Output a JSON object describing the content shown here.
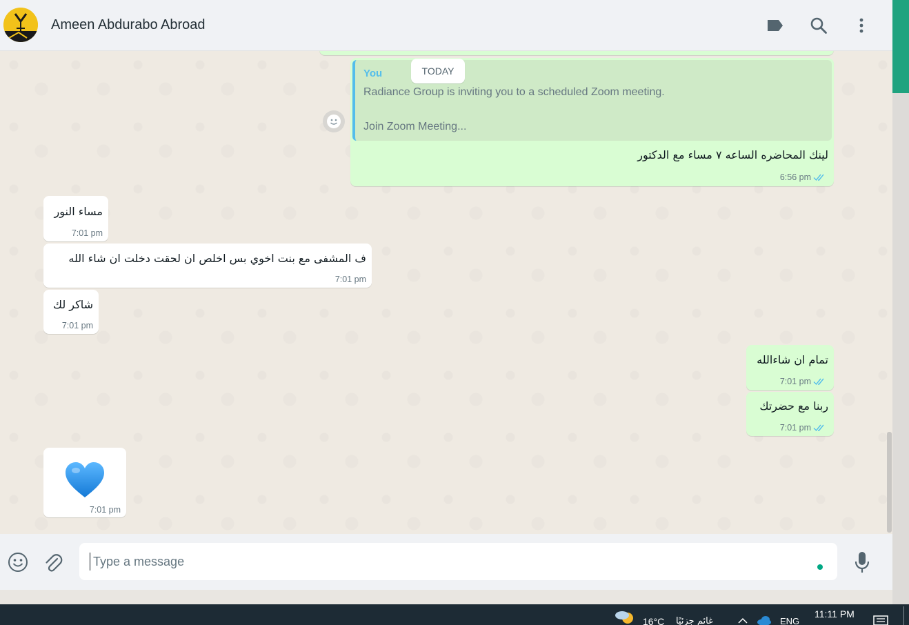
{
  "colors": {
    "accent": "#00a884",
    "outgoing_bubble": "#d9fdd3",
    "incoming_bubble": "#ffffff",
    "tick_read": "#53bdeb",
    "chat_bg": "#efeae2"
  },
  "header": {
    "contact_name": "Ameen Abdurabo Abroad",
    "icons": [
      "label-icon",
      "search-icon",
      "menu-dots-icon"
    ]
  },
  "chat": {
    "date_divider": "TODAY",
    "messages": [
      {
        "direction": "out",
        "quote": {
          "author": "You",
          "line1": "Radiance Group is inviting you to a scheduled Zoom meeting.",
          "line2": "Join Zoom Meeting..."
        },
        "text": "لينك المحاضره الساعه ٧ مساء مع الدكتور",
        "time": "6:56 pm",
        "status": "read"
      },
      {
        "direction": "in",
        "text": "مساء النور",
        "time": "7:01 pm"
      },
      {
        "direction": "in",
        "text": "ف المشفى مع بنت اخوي بس اخلص ان لحقت دخلت ان شاء الله",
        "time": "7:01 pm"
      },
      {
        "direction": "in",
        "text": "شاكر لك",
        "time": "7:01 pm"
      },
      {
        "direction": "out",
        "text": "تمام ان شاءالله",
        "time": "7:01 pm",
        "status": "read"
      },
      {
        "direction": "out",
        "text": "ربنا مع حضرتك",
        "time": "7:01 pm",
        "status": "read"
      },
      {
        "direction": "in",
        "text": "💙",
        "time": "7:01 pm"
      }
    ]
  },
  "composer": {
    "placeholder": "Type a message",
    "icons": [
      "emoji-icon",
      "attach-icon",
      "mic-icon"
    ]
  },
  "taskbar": {
    "weather_temp": "16°C",
    "weather_desc": "غائم جزئيًا",
    "language": "ENG",
    "clock": "11:11 PM"
  }
}
